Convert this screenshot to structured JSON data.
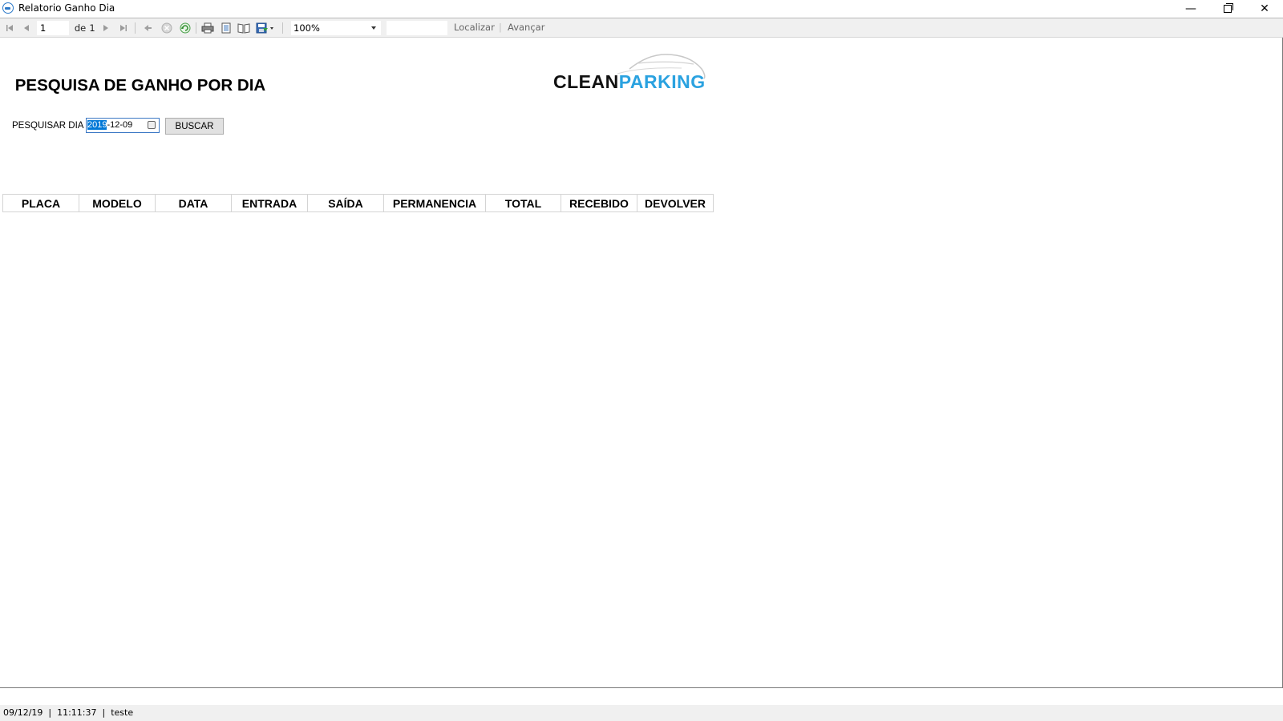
{
  "window": {
    "title": "Relatorio Ganho Dia",
    "minimize_glyph": "—",
    "close_glyph": "✕"
  },
  "toolbar": {
    "current_page": "1",
    "of_label": "de",
    "total_pages": "1",
    "zoom": "100%",
    "find_label": "Localizar",
    "separator": "|",
    "next_label": "Avançar",
    "icons": [
      "first-page-icon",
      "previous-page-icon",
      "next-page-icon",
      "last-page-icon",
      "back-icon",
      "stop-icon",
      "refresh-icon",
      "print-icon",
      "print-layout-icon",
      "page-setup-icon",
      "export-icon"
    ]
  },
  "report": {
    "title": "PESQUISA DE GANHO POR DIA",
    "logo": {
      "part1": "CLEAN",
      "part2": "PARKING"
    },
    "search_label": "PESQUISAR DIA",
    "date_year": "2019",
    "date_rest": "-12-09",
    "search_button": "BUSCAR",
    "columns": [
      "PLACA",
      "MODELO",
      "DATA",
      "ENTRADA",
      "SAÍDA",
      "PERMANENCIA",
      "TOTAL",
      "RECEBIDO",
      "DEVOLVER"
    ]
  },
  "status": {
    "text": "09/12/19  |  11:11:37  |  teste"
  },
  "colors": {
    "brand_dark": "#111111",
    "brand_accent": "#2aa2e0",
    "selection": "#0078d7"
  }
}
